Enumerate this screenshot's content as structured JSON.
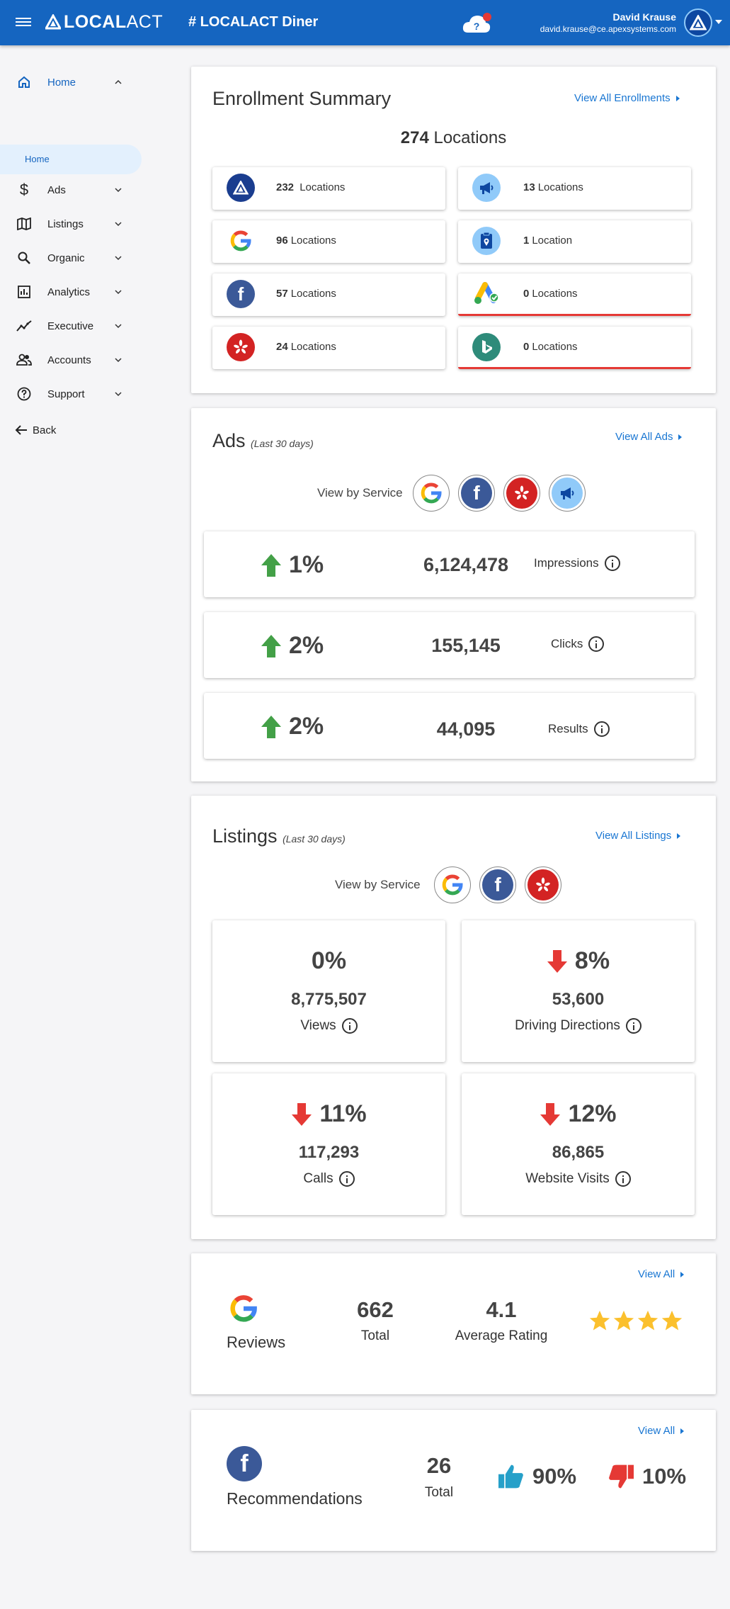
{
  "header": {
    "app_name_bold": "LOCAL",
    "app_name_light": "ACT",
    "title": "# LOCALACT Diner",
    "help_symbol": "?",
    "user_name": "David Krause",
    "user_email": "david.krause@ce.apexsystems.com",
    "brand_color": "#1565c0"
  },
  "sidebar": {
    "items": [
      {
        "label": "Home",
        "icon": "home-icon"
      },
      {
        "label": "Ads",
        "icon": "dollar-icon"
      },
      {
        "label": "Listings",
        "icon": "map-icon"
      },
      {
        "label": "Organic",
        "icon": "search-icon"
      },
      {
        "label": "Analytics",
        "icon": "bar-chart-icon"
      },
      {
        "label": "Executive",
        "icon": "trending-icon"
      },
      {
        "label": "Accounts",
        "icon": "people-icon"
      },
      {
        "label": "Support",
        "icon": "help-circle-icon"
      }
    ],
    "sub_item": "Home",
    "back_label": "Back"
  },
  "enrollment": {
    "title": "Enrollment Summary",
    "view_all": "View All Enrollments",
    "total_count": "274",
    "total_unit": "Locations",
    "services": [
      {
        "count": "232",
        "unit": "Locations",
        "icon": "localact-logo-icon"
      },
      {
        "count": "13",
        "unit": "Locations",
        "icon": "megaphone-icon"
      },
      {
        "count": "96",
        "unit": "Locations",
        "icon": "google-icon"
      },
      {
        "count": "1",
        "unit": "Location",
        "icon": "clipboard-location-icon"
      },
      {
        "count": "57",
        "unit": "Locations",
        "icon": "facebook-icon"
      },
      {
        "count": "0",
        "unit": "Locations",
        "icon": "google-ads-icon"
      },
      {
        "count": "24",
        "unit": "Locations",
        "icon": "yelp-icon"
      },
      {
        "count": "0",
        "unit": "Locations",
        "icon": "bing-icon"
      }
    ]
  },
  "ads": {
    "title": "Ads",
    "period": "(Last 30 days)",
    "view_all": "View All Ads",
    "view_by": "View by Service",
    "rows": [
      {
        "percent": "1%",
        "value": "6,124,478",
        "label": "Impressions",
        "trend": "up"
      },
      {
        "percent": "2%",
        "value": "155,145",
        "label": "Clicks",
        "trend": "up"
      },
      {
        "percent": "2%",
        "value": "44,095",
        "label": "Results",
        "trend": "up"
      }
    ]
  },
  "listings": {
    "title": "Listings",
    "period": "(Last 30 days)",
    "view_all": "View All Listings",
    "view_by": "View by Service",
    "tiles": [
      {
        "percent": "0%",
        "value": "8,775,507",
        "label": "Views",
        "trend": "none"
      },
      {
        "percent": "8%",
        "value": "53,600",
        "label": "Driving Directions",
        "trend": "down"
      },
      {
        "percent": "11%",
        "value": "117,293",
        "label": "Calls",
        "trend": "down"
      },
      {
        "percent": "12%",
        "value": "86,865",
        "label": "Website Visits",
        "trend": "down"
      }
    ]
  },
  "reviews": {
    "view_all": "View All",
    "label": "Reviews",
    "total": "662",
    "total_label": "Total",
    "average": "4.1",
    "average_label": "Average Rating",
    "stars": 4
  },
  "recommendations": {
    "view_all": "View All",
    "label": "Recommendations",
    "total": "26",
    "total_label": "Total",
    "positive": "90%",
    "negative": "10%"
  },
  "colors": {
    "up": "#43a047",
    "down": "#e53935",
    "link": "#1976d2",
    "star": "#fbc02d"
  }
}
